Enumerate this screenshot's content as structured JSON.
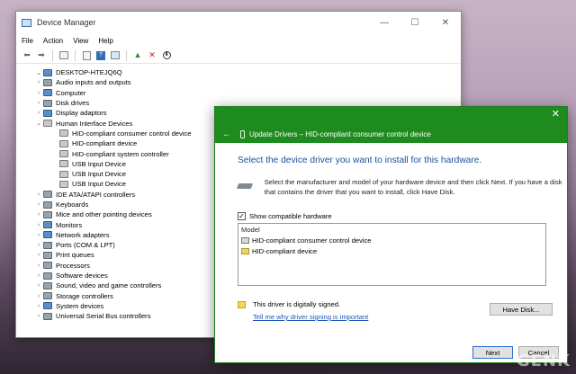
{
  "device_manager": {
    "title": "Device Manager",
    "window_buttons": [
      "—",
      "☐",
      "✕"
    ],
    "menu": [
      "File",
      "Action",
      "View",
      "Help"
    ],
    "toolbar_icons": [
      "back-arrow-icon",
      "forward-arrow-icon",
      "show-hide-console-icon",
      "properties-icon",
      "help-icon",
      "scan-hardware-icon",
      "update-driver-icon",
      "uninstall-icon",
      "disable-device-icon"
    ],
    "tree": [
      {
        "label": "DESKTOP-HTEJQ6Q",
        "arrow": "⌄",
        "level": 0,
        "icon": "comp"
      },
      {
        "label": "Audio inputs and outputs",
        "arrow": "›",
        "level": 1,
        "icon": "dev"
      },
      {
        "label": "Computer",
        "arrow": "›",
        "level": 1,
        "icon": "comp"
      },
      {
        "label": "Disk drives",
        "arrow": "›",
        "level": 1,
        "icon": "dev"
      },
      {
        "label": "Display adaptors",
        "arrow": "›",
        "level": 1,
        "icon": "comp"
      },
      {
        "label": "Human Interface Devices",
        "arrow": "⌄",
        "level": 1,
        "icon": "hid"
      },
      {
        "label": "HID-compliant consumer control device",
        "arrow": "",
        "level": 2,
        "icon": "hid"
      },
      {
        "label": "HID-compliant device",
        "arrow": "",
        "level": 2,
        "icon": "hid"
      },
      {
        "label": "HID-compliant system controller",
        "arrow": "",
        "level": 2,
        "icon": "hid"
      },
      {
        "label": "USB Input Device",
        "arrow": "",
        "level": 2,
        "icon": "hid"
      },
      {
        "label": "USB Input Device",
        "arrow": "",
        "level": 2,
        "icon": "hid"
      },
      {
        "label": "USB Input Device",
        "arrow": "",
        "level": 2,
        "icon": "hid"
      },
      {
        "label": "IDE ATA/ATAPI controllers",
        "arrow": "›",
        "level": 1,
        "icon": "dev"
      },
      {
        "label": "Keyboards",
        "arrow": "›",
        "level": 1,
        "icon": "dev"
      },
      {
        "label": "Mice and other pointing devices",
        "arrow": "›",
        "level": 1,
        "icon": "dev"
      },
      {
        "label": "Monitors",
        "arrow": "›",
        "level": 1,
        "icon": "comp"
      },
      {
        "label": "Network adapters",
        "arrow": "›",
        "level": 1,
        "icon": "comp"
      },
      {
        "label": "Ports (COM & LPT)",
        "arrow": "›",
        "level": 1,
        "icon": "dev"
      },
      {
        "label": "Print queues",
        "arrow": "›",
        "level": 1,
        "icon": "dev"
      },
      {
        "label": "Processors",
        "arrow": "›",
        "level": 1,
        "icon": "dev"
      },
      {
        "label": "Software devices",
        "arrow": "›",
        "level": 1,
        "icon": "dev"
      },
      {
        "label": "Sound, video and game controllers",
        "arrow": "›",
        "level": 1,
        "icon": "dev"
      },
      {
        "label": "Storage controllers",
        "arrow": "›",
        "level": 1,
        "icon": "dev"
      },
      {
        "label": "System devices",
        "arrow": "›",
        "level": 1,
        "icon": "comp"
      },
      {
        "label": "Universal Serial Bus controllers",
        "arrow": "›",
        "level": 1,
        "icon": "dev"
      }
    ]
  },
  "update_drivers": {
    "close": "✕",
    "back": "←",
    "header": "Update Drivers – HID-compliant consumer control device",
    "heading": "Select the device driver you want to install for this hardware.",
    "instructions": "Select the manufacturer and model of your hardware device and then click Next. If you have a disk that contains the driver that you want to install, click Have Disk.",
    "show_compatible_label": "Show compatible hardware",
    "show_compatible_checked": "✓",
    "list_header": "Model",
    "models": [
      {
        "label": "HID-compliant consumer control device",
        "selected": true
      },
      {
        "label": "HID-compliant device",
        "selected": false
      }
    ],
    "signed_text": "This driver is digitally signed.",
    "signing_link": "Tell me why driver signing is important",
    "have_disk_label": "Have Disk...",
    "next_label": "Next",
    "cancel_label": "Cancel"
  },
  "watermark": "GENK"
}
